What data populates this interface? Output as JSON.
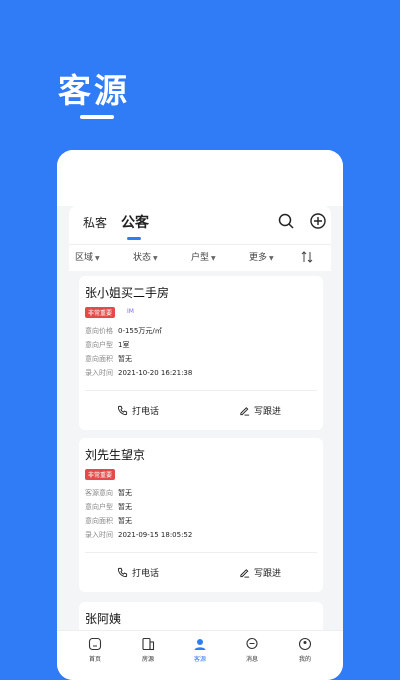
{
  "hero": {
    "title": "客源"
  },
  "header": {
    "tabs": [
      {
        "label": "私客"
      },
      {
        "label": "公客"
      }
    ]
  },
  "filters": [
    {
      "label": "区域"
    },
    {
      "label": "状态"
    },
    {
      "label": "户型"
    },
    {
      "label": "更多"
    }
  ],
  "cards": [
    {
      "title": "张小姐买二手房",
      "tag": "非常重要",
      "tag_secondary": "IM",
      "rows": [
        {
          "label": "意向价格",
          "value": "0-155万元/㎡"
        },
        {
          "label": "意向户型",
          "value": "1室"
        },
        {
          "label": "意向面积",
          "value": "暂无"
        },
        {
          "label": "录入时间",
          "value": "2021-10-20 16:21:38"
        }
      ],
      "call_label": "打电话",
      "follow_label": "写跟进"
    },
    {
      "title": "刘先生望京",
      "tag": "非常重要",
      "rows": [
        {
          "label": "客源意向",
          "value": "暂无"
        },
        {
          "label": "意向户型",
          "value": "暂无"
        },
        {
          "label": "意向面积",
          "value": "暂无"
        },
        {
          "label": "录入时间",
          "value": "2021-09-15 18:05:52"
        }
      ],
      "call_label": "打电话",
      "follow_label": "写跟进"
    },
    {
      "title": "张阿姨"
    }
  ],
  "tabbar": [
    {
      "label": "首页"
    },
    {
      "label": "房源"
    },
    {
      "label": "客源"
    },
    {
      "label": "消息"
    },
    {
      "label": "我的"
    }
  ],
  "colors": {
    "accent": "#2f7cf6",
    "tag": "#e34b4b"
  }
}
